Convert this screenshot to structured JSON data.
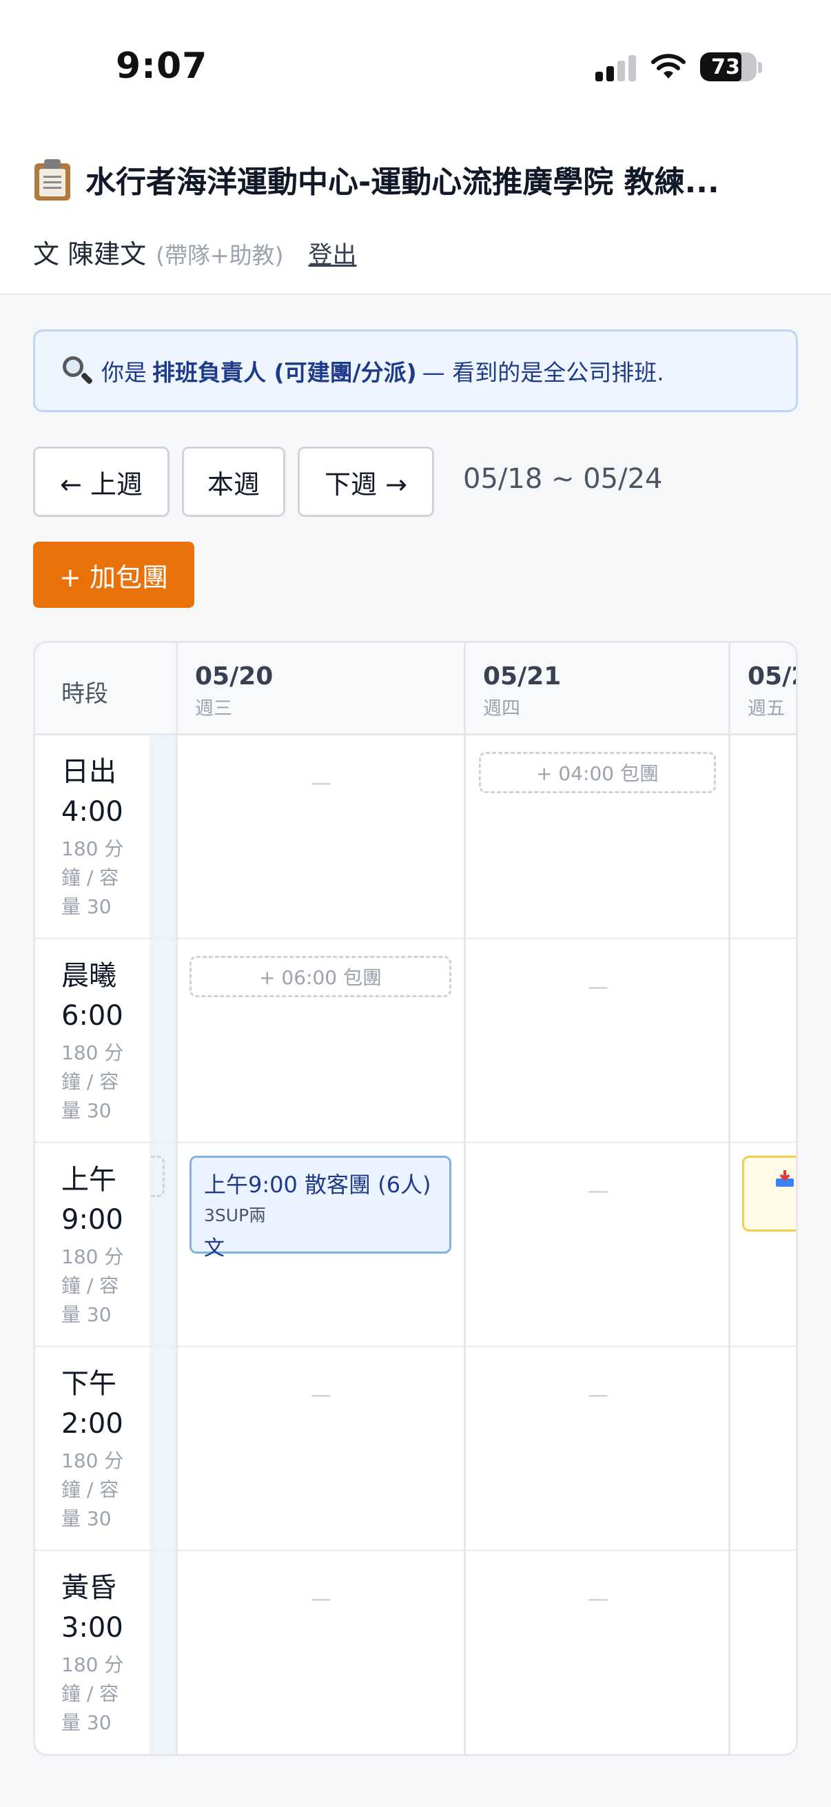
{
  "status_bar": {
    "time": "9:07",
    "battery": "73"
  },
  "header": {
    "title": "水行者海洋運動中心-運動心流推廣學院 教練...",
    "user_name": "文 陳建文",
    "user_role": "(帶隊+助教)",
    "logout": "登出"
  },
  "banner": {
    "prefix": "你是",
    "role": "排班負責人 (可建團/分派)",
    "suffix": "— 看到的是全公司排班."
  },
  "nav": {
    "prev": "← 上週",
    "this": "本週",
    "next": "下週 →",
    "range": "05/18 ~ 05/24",
    "add_group": "+ 加包團"
  },
  "table": {
    "slot_header": "時段",
    "days": [
      {
        "date": "05/20",
        "weekday": "週三"
      },
      {
        "date": "05/21",
        "weekday": "週四"
      },
      {
        "date": "05/2",
        "weekday": "週五"
      }
    ],
    "slots": [
      {
        "name": "日出",
        "time": "4:00",
        "meta": [
          "180 分",
          "鐘 / 容",
          "量 30"
        ]
      },
      {
        "name": "晨曦",
        "time": "6:00",
        "meta": [
          "180 分",
          "鐘 / 容",
          "量 30"
        ]
      },
      {
        "name": "上午",
        "time": "9:00",
        "meta": [
          "180 分",
          "鐘 / 容",
          "量 30"
        ]
      },
      {
        "name": "下午",
        "time": "2:00",
        "meta": [
          "180 分",
          "鐘 / 容",
          "量 30"
        ]
      },
      {
        "name": "黃昏",
        "time": "3:00",
        "meta": [
          "180 分",
          "鐘 / 容",
          "量 30"
        ]
      }
    ],
    "empty_mark": "—",
    "add_0400": "+ 04:00 包團",
    "add_0600": "+ 06:00 包團",
    "event": {
      "title": "上午9:00 散客團 (6人)",
      "sub": "3SUP兩",
      "who": "文"
    }
  },
  "colors": {
    "accent": "#e8710a",
    "event_border": "#7fb3e6",
    "banner_bg": "#eef5ff"
  }
}
